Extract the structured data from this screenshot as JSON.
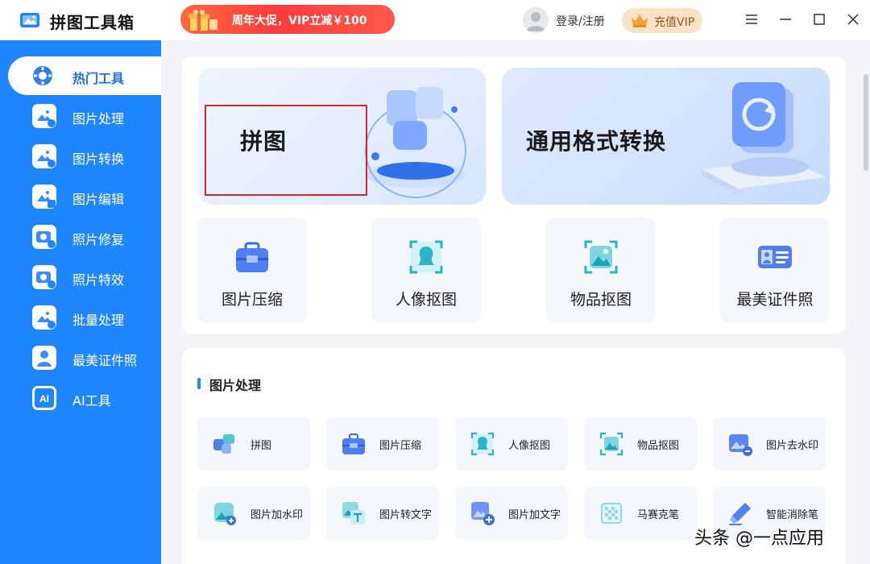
{
  "app": {
    "title": "拼图工具箱",
    "logo_icon": "image-toolbox-logo"
  },
  "promo": {
    "text": "周年大促，VIP立减￥100",
    "icon": "gift-icon"
  },
  "header": {
    "login_label": "登录/注册",
    "vip_label": "充值VIP",
    "avatar_icon": "user-avatar-icon",
    "vip_icon": "crown-icon",
    "window_controls": [
      "menu-icon",
      "minimize-icon",
      "maximize-icon",
      "close-icon"
    ]
  },
  "sidebar": {
    "items": [
      {
        "label": "热门工具",
        "icon": "gear-icon",
        "active": true
      },
      {
        "label": "图片处理",
        "icon": "image-process-icon"
      },
      {
        "label": "图片转换",
        "icon": "image-convert-icon"
      },
      {
        "label": "图片编辑",
        "icon": "image-edit-icon"
      },
      {
        "label": "照片修复",
        "icon": "photo-repair-icon"
      },
      {
        "label": "照片特效",
        "icon": "photo-effect-icon"
      },
      {
        "label": "批量处理",
        "icon": "batch-process-icon"
      },
      {
        "label": "最美证件照",
        "icon": "id-photo-icon"
      },
      {
        "label": "AI工具",
        "icon": "ai-icon"
      }
    ]
  },
  "banners": [
    {
      "title": "拼图",
      "icon": "puzzle-icon"
    },
    {
      "title": "通用格式转换",
      "icon": "format-convert-icon"
    }
  ],
  "quick_tools": [
    {
      "label": "图片压缩",
      "icon": "toolbox-icon"
    },
    {
      "label": "人像抠图",
      "icon": "portrait-cutout-icon"
    },
    {
      "label": "物品抠图",
      "icon": "object-cutout-icon"
    },
    {
      "label": "最美证件照",
      "icon": "id-card-icon"
    }
  ],
  "section": {
    "title": "图片处理",
    "tools": [
      {
        "label": "拼图",
        "icon": "puzzle-icon"
      },
      {
        "label": "图片压缩",
        "icon": "toolbox-icon"
      },
      {
        "label": "人像抠图",
        "icon": "portrait-cutout-icon"
      },
      {
        "label": "物品抠图",
        "icon": "object-cutout-icon"
      },
      {
        "label": "图片去水印",
        "icon": "remove-watermark-icon"
      },
      {
        "label": "图片加水印",
        "icon": "add-watermark-icon"
      },
      {
        "label": "图片转文字",
        "icon": "image-to-text-icon"
      },
      {
        "label": "图片加文字",
        "icon": "add-text-icon"
      },
      {
        "label": "马赛克笔",
        "icon": "mosaic-icon"
      },
      {
        "label": "智能消除笔",
        "icon": "smart-eraser-icon"
      }
    ]
  },
  "watermark": {
    "text": "头条 @一点应用"
  },
  "colors": {
    "brand_blue": "#1e86ff",
    "promo_red": "#ff3b3b",
    "highlight_red": "#e02323",
    "vip_gold": "#fbe2c4"
  }
}
